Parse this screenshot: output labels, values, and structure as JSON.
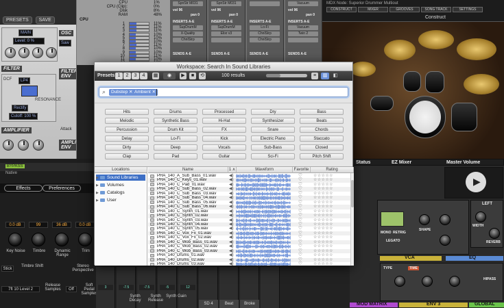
{
  "background": {
    "synth": {
      "tabs": [
        "PRESETS",
        "SAVE"
      ],
      "sections": [
        "OSC",
        "FILTER",
        "FILTER ENV",
        "AMPLIFIER",
        "AMPLIFIER ENV"
      ],
      "labels": {
        "level": "Level: 0 %",
        "mode": "Rectify",
        "filter_type": "LP4",
        "cutoff": "Cutoff: 100 %",
        "attack": "Attack",
        "resonance": "RESONANCE",
        "saw": "Saw",
        "dcf": "DCF",
        "main": "MAIN"
      }
    },
    "cpu": {
      "header": "CPU",
      "rows": [
        {
          "label": "CPU",
          "value": "1%"
        },
        {
          "label": "CPU (Clip):",
          "value": "0%"
        },
        {
          "label": "Disk",
          "value": "8%"
        },
        {
          "label": "RAM",
          "value": "48%"
        }
      ],
      "core_label": "CPU",
      "cores": [
        {
          "n": "1",
          "v": "11%"
        },
        {
          "n": "2",
          "v": "11%"
        },
        {
          "n": "3",
          "v": "11%"
        },
        {
          "n": "4",
          "v": "10%"
        },
        {
          "n": "5",
          "v": "10%"
        },
        {
          "n": "6",
          "v": "10%"
        },
        {
          "n": "7",
          "v": "11%"
        },
        {
          "n": "8",
          "v": "10%"
        },
        {
          "n": "9",
          "v": "10%"
        },
        {
          "n": "10",
          "v": "11%"
        },
        {
          "n": "11",
          "v": "10%"
        },
        {
          "n": "12",
          "v": "10%"
        }
      ]
    },
    "mixer": {
      "inserts": "INSERTS A-E",
      "sends": "SENDS A-E",
      "channels": [
        {
          "top": "SpnStr M031",
          "p1": "SupDrumM",
          "p2": "X-Quality",
          "p3": "ChnlStrp",
          "p4": "",
          "vol": "vol 96",
          "pan": "pan 0"
        },
        {
          "top": "SpnStr M031",
          "p1": "SupDrumM",
          "p2": "Elixr v3",
          "p3": "",
          "p4": "",
          "vol": "vol 96",
          "pan": "pan 0"
        },
        {
          "top": "",
          "p1": "Lo-Fi",
          "p2": "ChnlStrp",
          "p3": "ChnlStrp",
          "p4": "",
          "vol": "",
          "pan": ""
        },
        {
          "top": "Vacuum",
          "p1": "Vacuum",
          "p2": "Twin 2",
          "p3": "",
          "p4": "",
          "vol": "vol 96",
          "pan": "pan 0"
        }
      ]
    },
    "drums": {
      "host": "MDX Node: Superior Drummer Multiout",
      "tabs": [
        "CONSTRUCT",
        "MIXER",
        "GROOVES",
        "SONG TRACK",
        "SETTINGS"
      ],
      "kit": "Construct"
    },
    "left_low": {
      "bypass": "BYPASS",
      "native": "Native",
      "effects": "Effects",
      "preferences": "Preferences",
      "knobs": [
        {
          "label": "Key Noise",
          "value": "0.0 dB"
        },
        {
          "label": "Timbre",
          "value": "99"
        },
        {
          "label": "Dynamic Range",
          "value": "36 dB"
        },
        {
          "label": "Trim",
          "value": "0.0 dB"
        }
      ],
      "extra_labels": [
        "Timbre Shift",
        "Stereo Perspective",
        "Release Samples",
        "Soft Pedal Samples"
      ],
      "preset": "7ft 10 Level 2",
      "pedal": "Off",
      "preset2": "Stick"
    },
    "mid_low": {
      "tracks": [
        "SD 4",
        "Beat",
        "Broke"
      ],
      "values": [
        "3",
        "-7.5",
        "-7.5",
        "-5",
        "12"
      ],
      "knob_labels": [
        "Synth Decay",
        "Synth Release",
        "Synth Gain"
      ]
    },
    "right_low": {
      "status": "Status",
      "ez_mixer": "EZ Mixer",
      "master_volume": "Master Volume",
      "left": "LEFT",
      "right": "RIGHT",
      "width": "WIDTH",
      "shape": "SHAPE",
      "vca": "VCA",
      "eq": "EQ",
      "env3": "ENV 3",
      "mod_matrix": "MOD MATRIX",
      "global": "GLOBAL",
      "mono": "MONO",
      "reverb": "REVERB",
      "legato": "LEGATO",
      "retrig": "RETRIG",
      "hipass": "HIPASS",
      "type": "TYPE",
      "time": "TIME"
    }
  },
  "window": {
    "title": "Workspace: Search In Sound Libraries",
    "toolbar": {
      "presets_label": "Presets:",
      "presets": [
        "1",
        "2",
        "3",
        "4"
      ],
      "results": "100 results"
    },
    "progress": 0.35,
    "search": {
      "icon": "magnifier-icon",
      "tags": [
        "Dubstep",
        "Ambient"
      ],
      "query": ""
    },
    "tag_buttons": [
      [
        "Hits",
        "Drums",
        "Processed",
        "Dry",
        "Bass"
      ],
      [
        "Melodic",
        "Synthetic Bass",
        "Hi-Hat",
        "Synthesizer",
        "Beats"
      ],
      [
        "Percussion",
        "Drum Kit",
        "FX",
        "Snare",
        "Chords"
      ],
      [
        "Delay",
        "Lo-Fi",
        "Kick",
        "Electric Piano",
        "Staccato"
      ],
      [
        "Dirty",
        "Deep",
        "Vocals",
        "Sub-Bass",
        "Closed"
      ],
      [
        "Clap",
        "Pad",
        "Guitar",
        "Sci-Fi",
        "Pitch Shift"
      ]
    ],
    "locations": {
      "header": "Locations",
      "items": [
        {
          "label": "Sound Libraries",
          "selected": true,
          "level": 0
        },
        {
          "label": "Volumes",
          "selected": false,
          "level": 1
        },
        {
          "label": "Catalogs",
          "selected": false,
          "level": 1
        },
        {
          "label": "User",
          "selected": false,
          "level": 1
        }
      ]
    },
    "columns": {
      "name": "Name",
      "num": "1 ∧",
      "waveform": "Waveform",
      "favorite": "Favorite",
      "rating": "Rating"
    },
    "files": [
      "PHA_140_A_Sub_Bass_01.wav",
      "PHA_140_C_Keys_01.wav",
      "PHA_140_C_Pad_01.wav",
      "PHA_140_C_Sub_Bass_02.wav",
      "PHA_140_C_Sub_Bass_03.wav",
      "PHA_140_C_Sub_Bass_04.wav",
      "PHA_140_C_Sub_Bass_05.wav",
      "PHA_140_C_Sub_Bass_06.wav",
      "PHA_140_C_Synth_01.wav",
      "PHA_140_C_Synth_02.wav",
      "PHA_140_C_Synth_03.wav",
      "PHA_140_C_Synth_04.wav",
      "PHA_140_C_Synth_05.wav",
      "PHA_140_C_Vox_Fx_01.wav",
      "PHA_140_C_Vox_Fx_02.wav",
      "PHA_140_C_Wob_Bass_01.wav",
      "PHA_140_C_Wob_Bass_02.wav",
      "PHA_140_C_Wob_Bass_03.wav",
      "PHA_140_Drums_01.wav",
      "PHA_140_Drums_02.wav",
      "PHA_140_Drums_03.wav"
    ],
    "favorite_glyph": "♡",
    "rating_glyph": "☆☆☆☆☆",
    "speaker_glyph": "◀)",
    "waveform_color": "#6a8fd8"
  }
}
